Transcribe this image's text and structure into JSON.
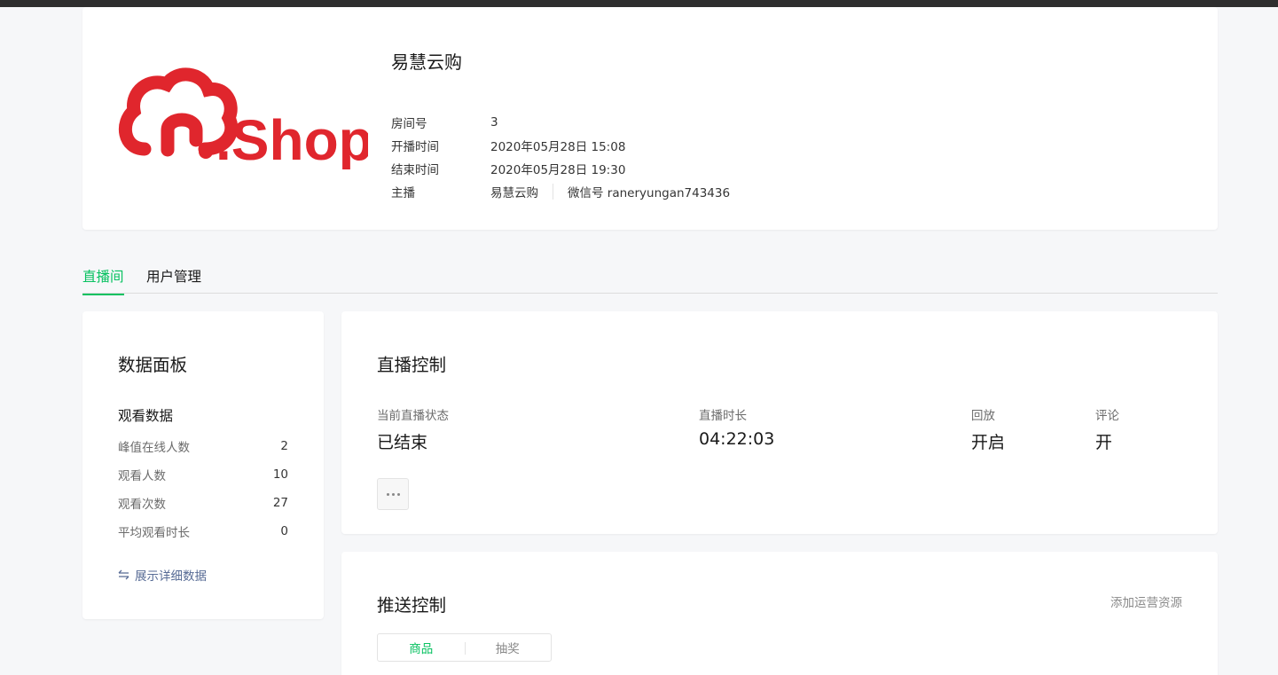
{
  "room": {
    "title": "易慧云购",
    "logo_text": ".Shop",
    "fields": [
      {
        "label": "房间号",
        "value": "3"
      },
      {
        "label": "开播时间",
        "value": "2020年05月28日 15:08"
      },
      {
        "label": "结束时间",
        "value": "2020年05月28日 19:30"
      }
    ],
    "anchor": {
      "label": "主播",
      "name": "易慧云购",
      "wechat": "微信号 raneryungan743436"
    }
  },
  "tabs": [
    {
      "label": "直播间",
      "active": true
    },
    {
      "label": "用户管理",
      "active": false
    }
  ],
  "data_panel": {
    "title": "数据面板",
    "section": "观看数据",
    "stats": [
      {
        "label": "峰值在线人数",
        "value": "2"
      },
      {
        "label": "观看人数",
        "value": "10"
      },
      {
        "label": "观看次数",
        "value": "27"
      },
      {
        "label": "平均观看时长",
        "value": "0"
      }
    ],
    "detail_link": "展示详细数据"
  },
  "live_control": {
    "title": "直播控制",
    "status_label": "当前直播状态",
    "status_value": "已结束",
    "duration_label": "直播时长",
    "duration_value": "04:22:03",
    "replay_label": "回放",
    "replay_value": "开启",
    "comment_label": "评论",
    "comment_value": "开"
  },
  "push_control": {
    "title": "推送控制",
    "add_link": "添加运营资源",
    "segments": [
      {
        "label": "商品",
        "active": true
      },
      {
        "label": "抽奖",
        "active": false
      }
    ]
  },
  "colors": {
    "accent": "#07c160",
    "logo_red": "#e0262d",
    "link": "#576b95"
  },
  "icons": {
    "more": "more-icon",
    "swap": "swap-icon"
  }
}
